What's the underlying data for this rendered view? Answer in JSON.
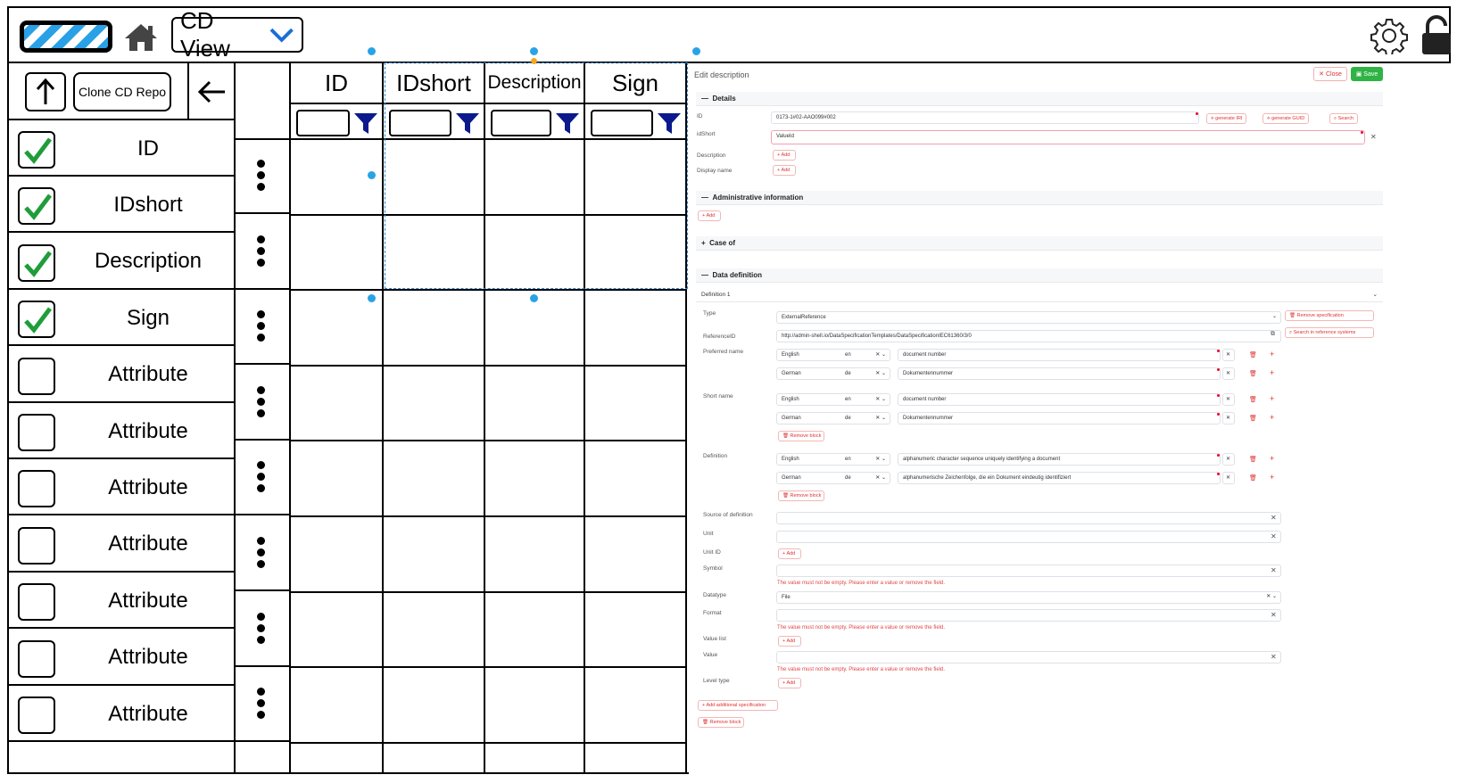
{
  "header": {
    "view_select": "CD View"
  },
  "left_panel": {
    "clone_button": "Clone CD Repo",
    "attributes": [
      {
        "label": "ID",
        "checked": true
      },
      {
        "label": "IDshort",
        "checked": true
      },
      {
        "label": "Description",
        "checked": true
      },
      {
        "label": "Sign",
        "checked": true
      },
      {
        "label": "Attribute",
        "checked": false
      },
      {
        "label": "Attribute",
        "checked": false
      },
      {
        "label": "Attribute",
        "checked": false
      },
      {
        "label": "Attribute",
        "checked": false
      },
      {
        "label": "Attribute",
        "checked": false
      },
      {
        "label": "Attribute",
        "checked": false
      },
      {
        "label": "Attribute",
        "checked": false
      }
    ]
  },
  "table": {
    "columns": [
      "ID",
      "IDshort",
      "Description",
      "Sign"
    ]
  },
  "editor": {
    "title": "Edit description",
    "close_label": "Close",
    "save_label": "Save",
    "details_title": "Details",
    "id_label": "ID",
    "id_value": "0173-1#02-AAO099#002",
    "generate_iri": "generate IRI",
    "generate_guid": "generate GUID",
    "search": "Search",
    "idshort_label": "idShort",
    "idshort_value": "ValueId",
    "description_label": "Description",
    "display_name_label": "Display name",
    "add_label": "Add",
    "admin_title": "Administrative information",
    "case_of_title": "Case of",
    "data_def_title": "Data definition",
    "definition_1": "Definition 1",
    "type_label": "Type",
    "type_value": "ExternalReference",
    "remove_specification": "Remove specification",
    "search_reference_systems": "Search in reference systems",
    "reference_id_label": "ReferenceID",
    "reference_id_value": "http://admin-shell.io/DataSpecificationTemplates/DataSpecificationIEC61360/3/0",
    "preferred_name_label": "Preferred name",
    "short_name_label": "Short name",
    "definition_label": "Definition",
    "lang_english": "English",
    "lang_german": "German",
    "code_en": "en",
    "code_de": "de",
    "pn_en": "document number",
    "pn_de": "Dokumentennummer",
    "sn_en": "document number",
    "sn_de": "Dokumentennummer",
    "def_en": "alphanumeric character sequence uniquely identifying a document",
    "def_de": "alphanumerische Zeichenfolge, die ein Dokument eindeutig identifiziert",
    "remove_block": "Remove block",
    "source_of_definition_label": "Source of definition",
    "unit_label": "Unit",
    "unit_id_label": "Unit ID",
    "symbol_label": "Symbol",
    "error_empty": "The value must not be empty. Please enter a value or remove the field.",
    "datatype_label": "Datatype",
    "datatype_value": "File",
    "format_label": "Format",
    "value_list_label": "Value list",
    "value_label": "Value",
    "level_type_label": "Level type",
    "add_additional_specification": "Add additional specification"
  },
  "colors": {
    "accent": "#29a3e6",
    "check": "#1f9d3a",
    "funnel": "#0a1a8c",
    "save": "#2fb344",
    "danger": "#d33333"
  }
}
